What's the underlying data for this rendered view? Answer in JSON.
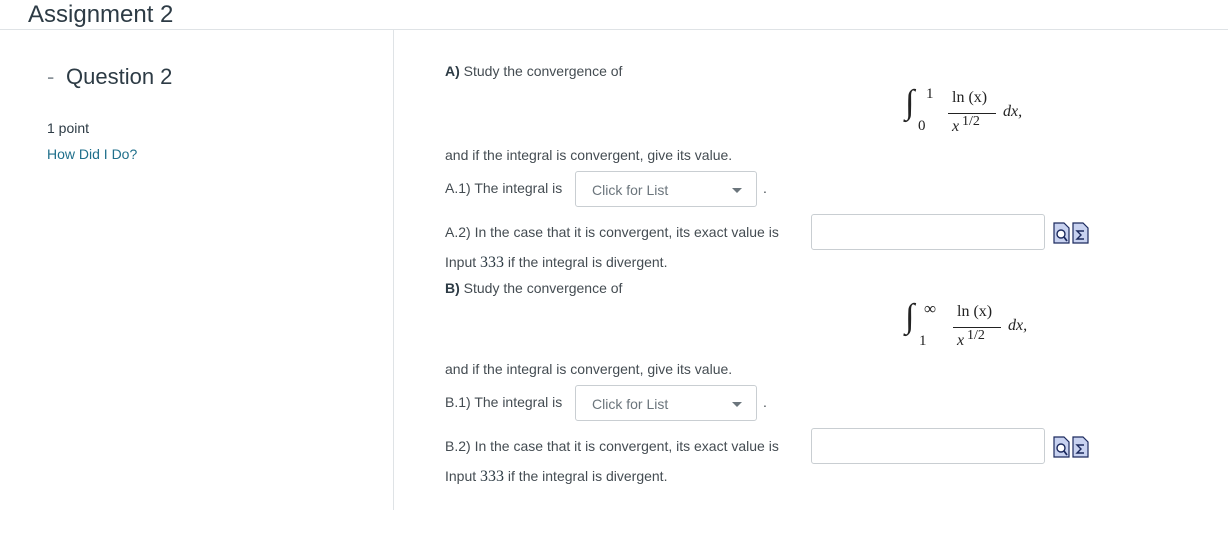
{
  "header": {
    "title": "Assignment 2"
  },
  "sidebar": {
    "question_title": "Question 2",
    "points": "1 point",
    "how_did_i_do": "How Did I Do?"
  },
  "partA": {
    "label": "A)",
    "intro": "Study the convergence of",
    "integral": {
      "lower": "0",
      "upper": "1",
      "numerator": "ln (x)",
      "denominator_base": "x",
      "denominator_exp": "1/2",
      "tail": "dx,"
    },
    "after": "and if the integral is convergent, give its value.",
    "a1_label": "A.1) The integral is",
    "a1_select": "Click for List",
    "a2_label": "A.2) In the case that it is convergent, its exact value is",
    "a2_value": "",
    "divergent_prefix": "Input",
    "divergent_number": "333",
    "divergent_suffix": "if the integral is divergent."
  },
  "partB": {
    "label": "B)",
    "intro": "Study the convergence of",
    "integral": {
      "lower": "1",
      "upper": "∞",
      "numerator": "ln (x)",
      "denominator_base": "x",
      "denominator_exp": "1/2",
      "tail": "dx,"
    },
    "after": "and if the integral is convergent, give its value.",
    "b1_label": "B.1) The integral is",
    "b1_select": "Click for List",
    "b2_label": "B.2) In the case that it is convergent, its exact value is",
    "b2_value": "",
    "divergent_prefix": "Input",
    "divergent_number": "333",
    "divergent_suffix": "if the integral is divergent."
  },
  "punctuation": {
    "period": "."
  },
  "icons": {
    "preview": "preview-answer-icon",
    "equation": "equation-editor-icon"
  }
}
